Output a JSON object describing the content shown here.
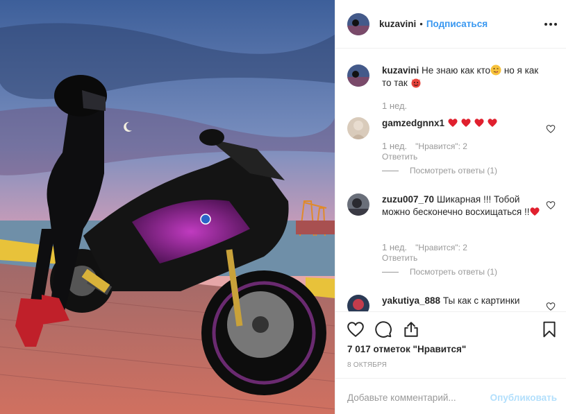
{
  "post": {
    "username": "kuzavini",
    "follow_label": "Подписаться",
    "separator": "•"
  },
  "caption": {
    "username": "kuzavini",
    "text_part1": "Не знаю как кто",
    "text_part2": " но я как то так ",
    "age": "1 нед."
  },
  "comments": [
    {
      "username": "gamzedgnnx1",
      "text": "",
      "age": "1 нед.",
      "likes": "\"Нравится\": 2",
      "reply_label": "Ответить",
      "view_replies": "Посмотреть ответы (1)"
    },
    {
      "username": "zuzu007_70",
      "text": "Шикарная !!! Тобой можно бесконечно восхищаться !!",
      "age": "1 нед.",
      "likes": "\"Нравится\": 2",
      "reply_label": "Ответить",
      "view_replies": "Посмотреть ответы (1)"
    },
    {
      "username": "yakutiya_888",
      "text": "Ты как с картинки"
    }
  ],
  "likes_count": "7 017 отметок \"Нравится\"",
  "date": "8 ОКТЯБРЯ",
  "add_comment": {
    "placeholder": "Добавьте комментарий...",
    "publish_label": "Опубликовать"
  },
  "icons": {
    "like": "heart-icon",
    "comment": "comment-icon",
    "share": "share-icon",
    "save": "bookmark-icon",
    "more": "more-icon"
  },
  "colors": {
    "link": "#3897f0",
    "publish_disabled": "#b2dffc",
    "heart_red": "#ed4956",
    "muted": "#999999"
  }
}
